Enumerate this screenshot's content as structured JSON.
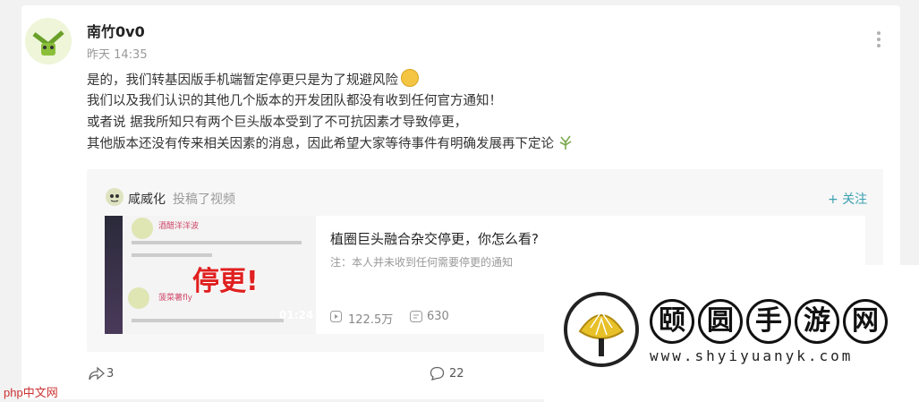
{
  "post": {
    "username": "南竹0v0",
    "time": "昨天 14:35",
    "lines": [
      "是的，我们转基因版手机端暂定停更只是为了规避风险",
      "我们以及我们认识的其他几个版本的开发团队都没有收到任何官方通知！",
      "或者说 据我所知只有两个巨头版本受到了不可抗因素才导致停更，",
      "其他版本还没有传来相关因素的消息，因此希望大家等待事件有明确发展再下定论"
    ]
  },
  "repost": {
    "author": "咸威化",
    "action": "投稿了视频",
    "follow_label": "+ 关注",
    "video": {
      "title": "植圈巨头融合杂交停更，你怎么看?",
      "note": "注：本人并未收到任何需要停更的通知",
      "views": "122.5万",
      "danmaku": "630",
      "duration": "01:24",
      "thumb_text": "停更!",
      "thumb_name1": "酒醋洋洋波",
      "thumb_name2": "菠菜薯fly"
    }
  },
  "actions": {
    "share_count": "3",
    "comment_count": "22"
  },
  "watermark": {
    "chars": [
      "颐",
      "圆",
      "手",
      "游",
      "网"
    ],
    "url": "www.shyiyuanyk.com"
  },
  "badge": "php中文网",
  "colors": {
    "accent": "#3aa0b0",
    "warning": "#e02020"
  }
}
